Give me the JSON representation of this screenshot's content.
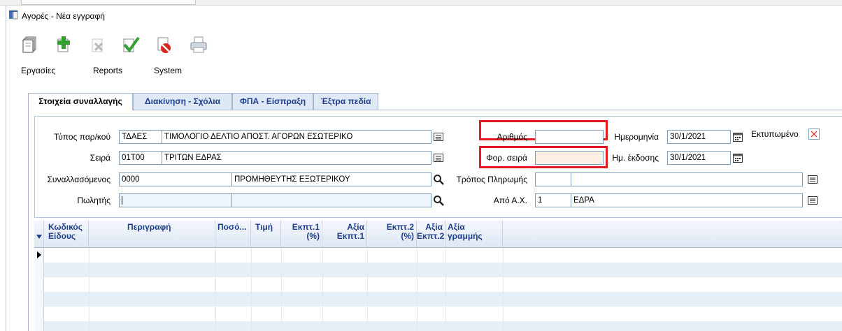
{
  "window": {
    "title": "Αγορές - Νέα εγγραφή"
  },
  "toolbar": {
    "icons": [
      "new-document-icon",
      "add-icon",
      "delete-icon",
      "save-check-icon",
      "cancel-icon",
      "print-icon"
    ],
    "menus": {
      "tasks": "Εργασίες",
      "reports": "Reports",
      "system": "System"
    }
  },
  "tabs": [
    {
      "label": "Στοιχεία συναλλαγής",
      "active": true
    },
    {
      "label": "Διακίνηση - Σχόλια",
      "active": false
    },
    {
      "label": "ΦΠΑ - Είσπραξη",
      "active": false
    },
    {
      "label": "Έξτρα πεδία",
      "active": false
    }
  ],
  "form": {
    "doc_type": {
      "label": "Τύπος παρ/κού",
      "code": "ΤΔΑΕΣ",
      "description": "ΤΙΜΟΛΟΓΙΟ ΔΕΛΤΙΟ ΑΠΟΣΤ. ΑΓΟΡΩΝ ΕΣΩΤΕΡΙΚΟ"
    },
    "series": {
      "label": "Σειρά",
      "code": "01Τ00",
      "description": "ΤΡΙΤΩΝ ΕΔΡΑΣ"
    },
    "counterparty": {
      "label": "Συναλλασόμενος",
      "code": "0000",
      "description": "ΠΡΟΜΗΘΕΥΤΗΣ ΕΞΩΤΕΡΙΚΟΥ"
    },
    "salesperson": {
      "label": "Πωλητής",
      "code": "",
      "description": ""
    },
    "number": {
      "label": "Αριθμός",
      "value": ""
    },
    "tax_series": {
      "label": "Φορ. σειρά",
      "value": ""
    },
    "date": {
      "label": "Ημερομηνία",
      "value": "30/1/2021"
    },
    "issue_date": {
      "label": "Ημ. έκδοσης",
      "value": "30/1/2021"
    },
    "printed": {
      "label": "Εκτυπωμένο",
      "checked": false
    },
    "payment_method": {
      "label": "Τρόπος Πληρωμής",
      "code": "",
      "description": ""
    },
    "warehouse": {
      "label": "Από Α.Χ.",
      "code": "1",
      "description": "ΕΔΡΑ"
    }
  },
  "grid": {
    "columns": [
      {
        "line1": "Κωδικός",
        "line2": "Είδους"
      },
      {
        "line1": "Περιγραφή",
        "line2": ""
      },
      {
        "line1": "Ποσό...",
        "line2": ""
      },
      {
        "line1": "Τιμή",
        "line2": ""
      },
      {
        "line1": "Εκπτ.1",
        "line2": "(%)"
      },
      {
        "line1": "Αξία",
        "line2": "Εκπτ.1"
      },
      {
        "line1": "Εκπτ.2",
        "line2": "(%)"
      },
      {
        "line1": "Αξία",
        "line2": "Εκπτ.2"
      },
      {
        "line1": "Αξία",
        "line2": "γραμμής"
      }
    ],
    "rows": 6
  },
  "colors": {
    "accent_blue": "#1e3f8c",
    "highlight_red": "#e01b22",
    "row_alt": "#e6eef8",
    "header_bg": "#dfe7f3"
  }
}
